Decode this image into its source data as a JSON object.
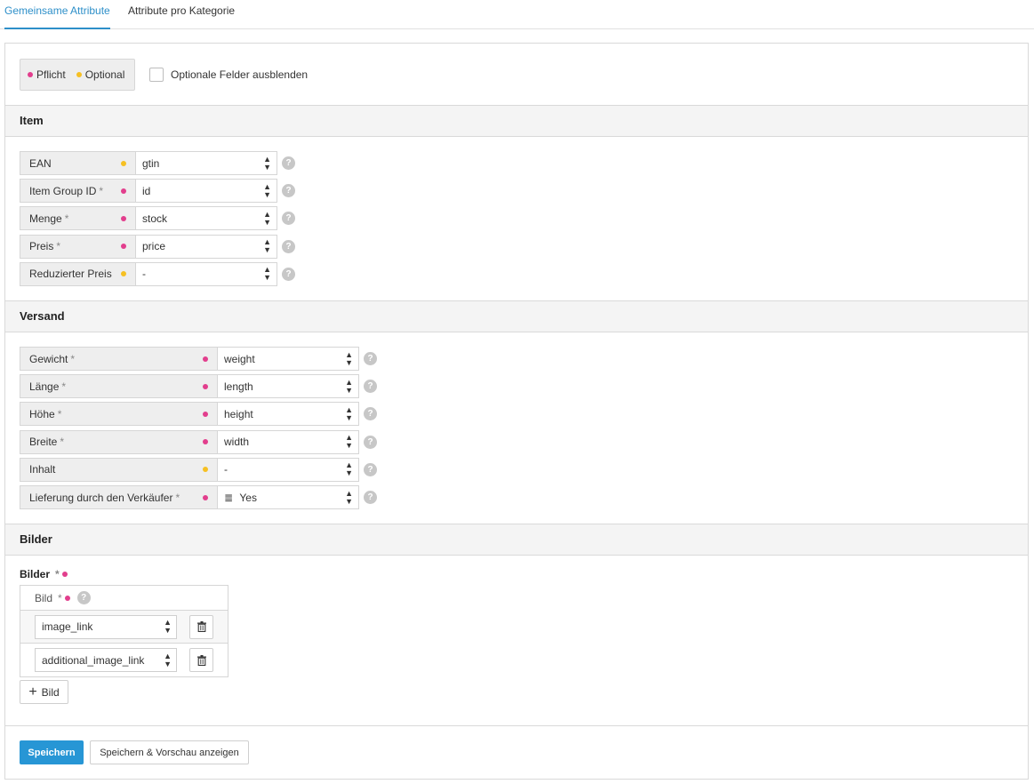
{
  "tabs": [
    {
      "label": "Gemeinsame Attribute",
      "active": true
    },
    {
      "label": "Attribute pro Kategorie",
      "active": false
    }
  ],
  "legend": {
    "required_label": "Pflicht",
    "optional_label": "Optional",
    "required_color": "#e23e8d",
    "optional_color": "#f6c023"
  },
  "hide_optional_label": "Optionale Felder ausblenden",
  "sections": {
    "item": {
      "title": "Item",
      "fields": [
        {
          "label": "EAN",
          "required": false,
          "value": "gtin"
        },
        {
          "label": "Item Group ID",
          "required": true,
          "value": "id"
        },
        {
          "label": "Menge",
          "required": true,
          "value": "stock"
        },
        {
          "label": "Preis",
          "required": true,
          "value": "price"
        },
        {
          "label": "Reduzierter Preis",
          "required": false,
          "value": "-"
        }
      ]
    },
    "versand": {
      "title": "Versand",
      "fields": [
        {
          "label": "Gewicht",
          "required": true,
          "value": "weight"
        },
        {
          "label": "Länge",
          "required": true,
          "value": "length"
        },
        {
          "label": "Höhe",
          "required": true,
          "value": "height"
        },
        {
          "label": "Breite",
          "required": true,
          "value": "width"
        },
        {
          "label": "Inhalt",
          "required": false,
          "value": "-"
        },
        {
          "label": "Lieferung durch den Verkäufer",
          "required": true,
          "value": "Yes",
          "value_icon": "list-icon"
        }
      ]
    },
    "bilder": {
      "title": "Bilder",
      "group_label": "Bilder",
      "column_label": "Bild",
      "rows": [
        "image_link",
        "additional_image_link"
      ],
      "add_label": "Bild"
    }
  },
  "star": "*",
  "help_glyph": "?",
  "actions": {
    "save_label": "Speichern",
    "save_preview_label": "Speichern & Vorschau anzeigen",
    "primary_color": "#2796d5"
  }
}
